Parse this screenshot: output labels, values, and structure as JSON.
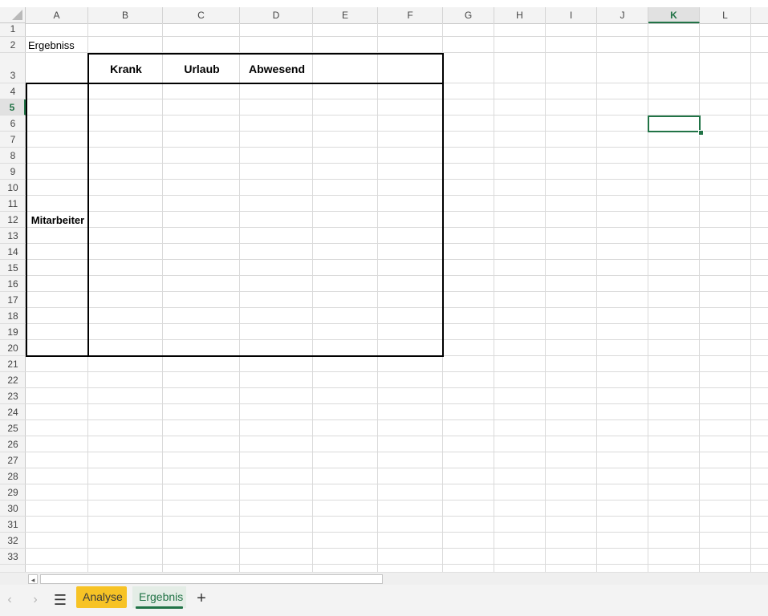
{
  "sheet": {
    "columns": [
      "A",
      "B",
      "C",
      "D",
      "E",
      "F",
      "G",
      "H",
      "I",
      "J",
      "K",
      "L"
    ],
    "rows": [
      "1",
      "2",
      "3",
      "4",
      "5",
      "6",
      "7",
      "8",
      "9",
      "10",
      "11",
      "12",
      "13",
      "14",
      "15",
      "16",
      "17",
      "18",
      "19",
      "20",
      "21",
      "22",
      "23",
      "24",
      "25",
      "26",
      "27",
      "28",
      "29",
      "30",
      "31",
      "32",
      "33"
    ],
    "selected_column": "K",
    "selected_row": "5",
    "cells": {
      "a1": "Ergebniss",
      "b2": "Krank",
      "c2": "Urlaub",
      "d2": "Abwesend",
      "a_merged": "Mitarbeiter"
    }
  },
  "tabs": {
    "items": [
      {
        "label": "Analyse",
        "color": "#f7c325"
      },
      {
        "label": "Ergebnis",
        "color": "#217346",
        "active": true
      }
    ],
    "prev_icon": "chevron-left-icon",
    "next_icon": "chevron-right-icon",
    "menu_icon": "hamburger-icon",
    "add_icon": "plus-icon"
  },
  "colors": {
    "accent": "#217346",
    "grid": "#dadada",
    "header_bg": "#f3f3f3"
  }
}
